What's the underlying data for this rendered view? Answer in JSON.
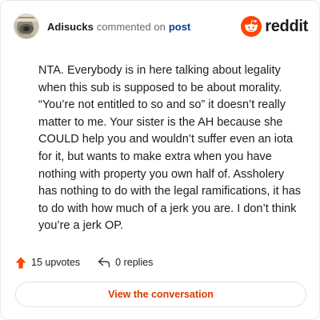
{
  "header": {
    "username": "Adisucks",
    "action": "commented on",
    "post_link": "post",
    "brand": "reddit"
  },
  "comment": {
    "text": "NTA. Everybody is in here talking about legality when this sub is supposed to be about morality. “You’re not entitled to so and so” it doesn’t really matter to me. Your sister is the AH because she COULD help you and wouldn’t suffer even an iota for it, but wants to make extra when you have nothing with property you own half of. Assholery has nothing to do with the legal ramifications, it has to do with how much of a jerk you are. I don’t think you’re a jerk OP."
  },
  "footer": {
    "upvotes": "15 upvotes",
    "replies": "0 replies"
  },
  "cta": {
    "label": "View the conversation"
  },
  "colors": {
    "brand_orange": "#ff4500",
    "cta_text": "#d93a00",
    "link_blue": "#0a3d91"
  },
  "icons": {
    "upvote": "upvote-arrow-icon",
    "reply": "reply-arrow-icon",
    "brand": "reddit-alien-icon"
  }
}
